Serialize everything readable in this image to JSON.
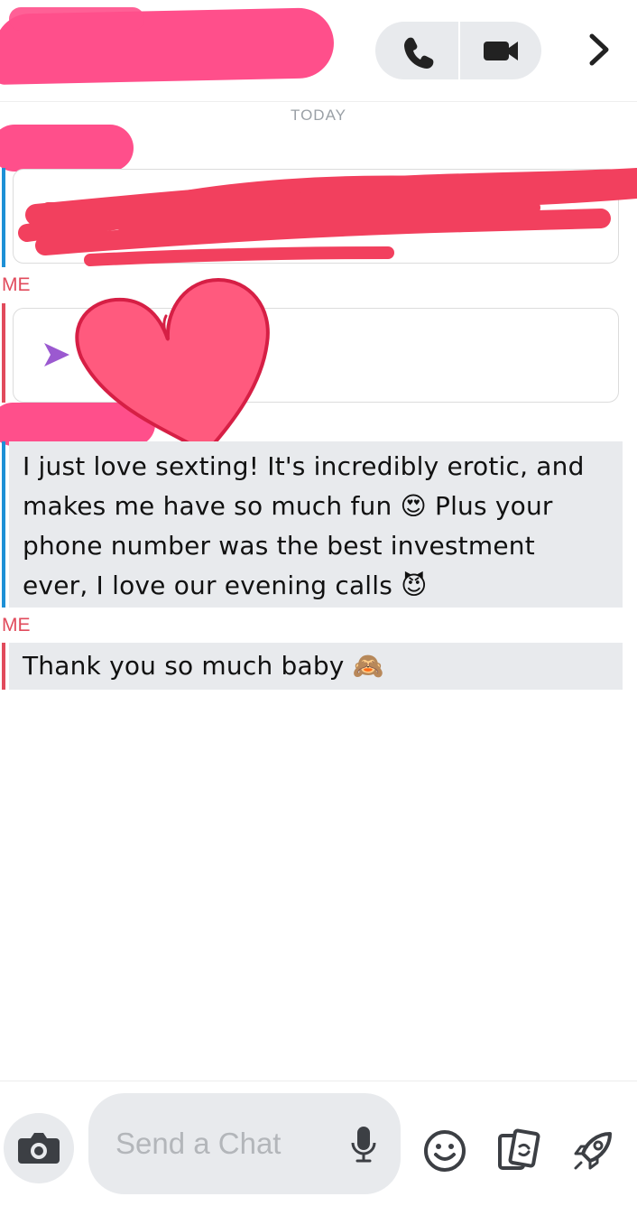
{
  "header": {
    "call_icon": "phone-icon",
    "video_icon": "video-camera-icon",
    "more_icon": "chevron-right-icon"
  },
  "day_label": "TODAY",
  "conversation": {
    "me_label_1": "ME",
    "me_label_2": "ME",
    "sent_snap_icon": "send-arrow-icon",
    "message_1": [
      "I just love sexting! It's incredibly erotic, and",
      "makes me have so much fun 😍 Plus your",
      "phone number was the best investment",
      "ever, I love our evening calls 😈"
    ],
    "message_2": "Thank you so much baby 🙈"
  },
  "composer": {
    "placeholder": "Send a Chat",
    "camera_icon": "camera-icon",
    "mic_icon": "microphone-icon",
    "emoji_icon": "smiley-icon",
    "stickers_icon": "cards-icon",
    "games_icon": "rocket-icon"
  },
  "colors": {
    "friend_accent": "#1e90d6",
    "me_accent": "#e14b5c",
    "bubble_bg": "#e8eaed",
    "snap_purple": "#9b59d0",
    "redaction_pink": "#ff4f8b",
    "redaction_red": "#f2405e"
  }
}
